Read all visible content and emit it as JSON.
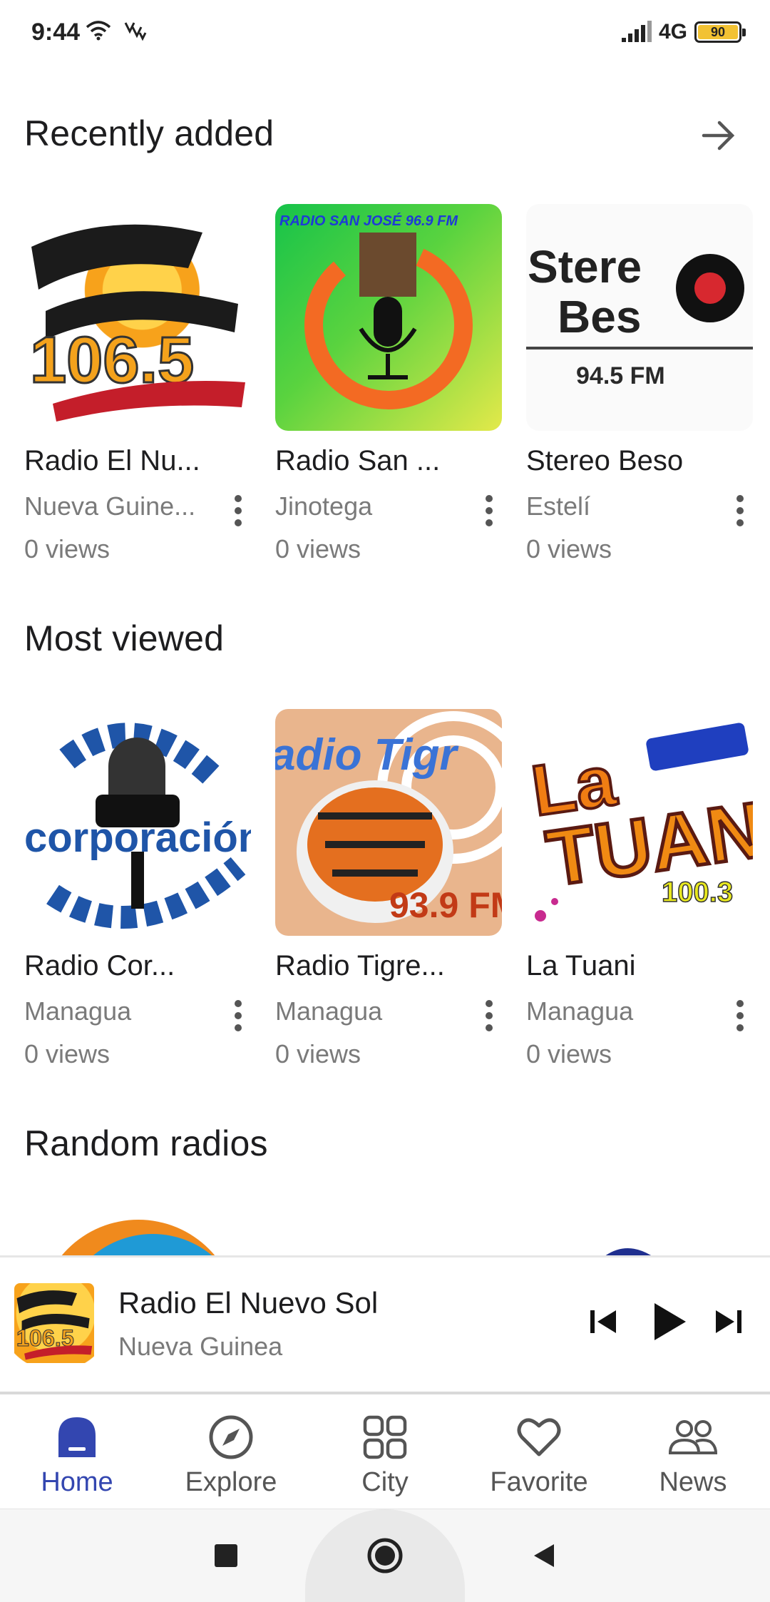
{
  "status_bar": {
    "time": "9:44",
    "network": "4G",
    "battery": "90"
  },
  "sections": {
    "recently_added": {
      "title": "Recently added",
      "items": [
        {
          "title": "Radio El Nu...",
          "city": "Nueva Guine...",
          "views": "0 views",
          "logo_text": "106.5"
        },
        {
          "title": "Radio San ...",
          "city": " Jinotega",
          "views": "0 views",
          "logo_text": "RADIO SAN JOSÉ 96.9 FM"
        },
        {
          "title": "Stereo Beso",
          "city": "Estelí",
          "views": "0 views",
          "logo_text": "94.5 FM"
        }
      ]
    },
    "most_viewed": {
      "title": "Most viewed",
      "items": [
        {
          "title": "Radio Cor...",
          "city": "Managua",
          "views": "0 views"
        },
        {
          "title": "Radio Tigre...",
          "city": "Managua",
          "views": "0 views",
          "logo_text": "93.9 FM"
        },
        {
          "title": "La Tuani",
          "city": "Managua",
          "views": "0 views"
        }
      ]
    },
    "random_radios": {
      "title": "Random radios"
    }
  },
  "player": {
    "title": "Radio El Nuevo Sol",
    "subtitle": "Nueva Guinea"
  },
  "bottom_nav": [
    {
      "label": "Home",
      "active": true
    },
    {
      "label": "Explore",
      "active": false
    },
    {
      "label": "City",
      "active": false
    },
    {
      "label": "Favorite",
      "active": false
    },
    {
      "label": "News",
      "active": false
    }
  ],
  "colors": {
    "accent": "#3346b0",
    "muted_text": "#7a7a7a"
  }
}
